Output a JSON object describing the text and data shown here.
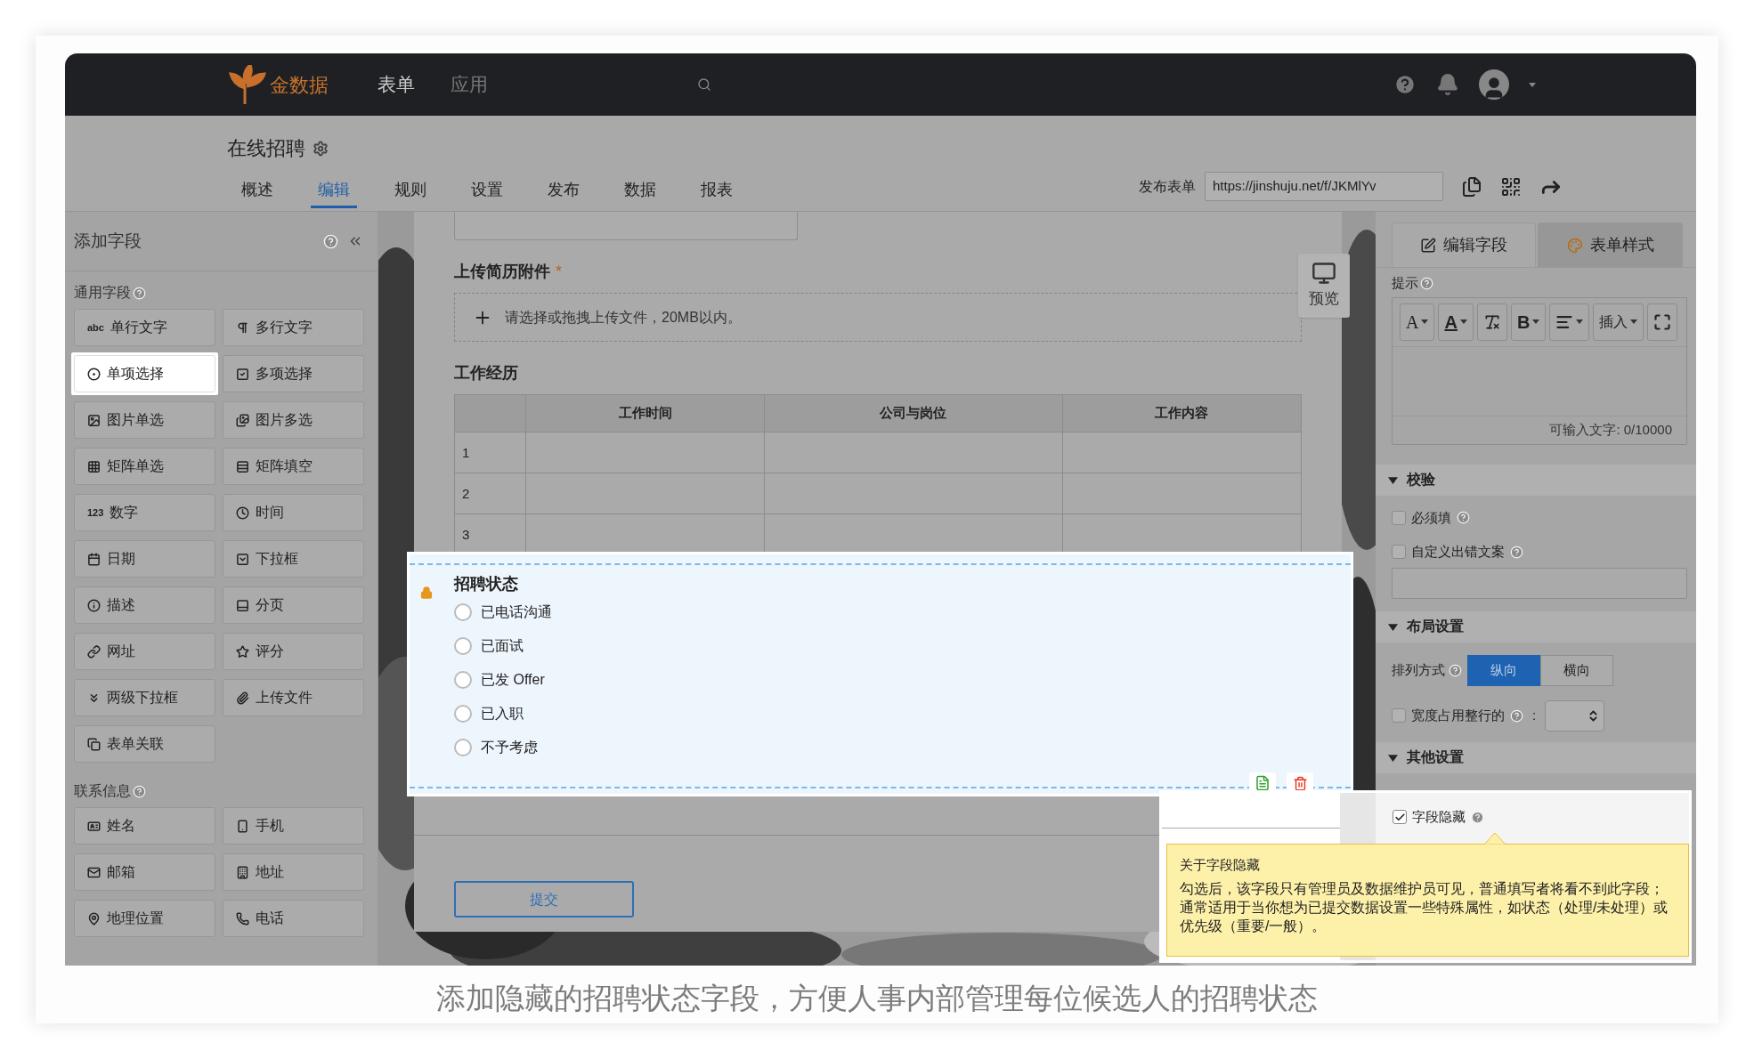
{
  "brand": {
    "name": "金数据"
  },
  "top_nav": [
    {
      "label": "表单",
      "selected": true
    },
    {
      "label": "应用",
      "selected": false
    }
  ],
  "form_title": "在线招聘",
  "tabs": [
    {
      "label": "概述",
      "selected": false
    },
    {
      "label": "编辑",
      "selected": true
    },
    {
      "label": "规则",
      "selected": false
    },
    {
      "label": "设置",
      "selected": false
    },
    {
      "label": "发布",
      "selected": false
    },
    {
      "label": "数据",
      "selected": false
    },
    {
      "label": "报表",
      "selected": false
    }
  ],
  "publish": {
    "label": "发布表单",
    "url": "https://jinshuju.net/f/JKMlYv"
  },
  "left_panel": {
    "title": "添加字段",
    "groups": [
      {
        "title": "通用字段",
        "items": [
          {
            "label": "单行文字",
            "glyph": "abc",
            "highlighted": false
          },
          {
            "label": "多行文字",
            "highlighted": false
          },
          {
            "label": "单项选择",
            "highlighted": true
          },
          {
            "label": "多项选择",
            "highlighted": false
          },
          {
            "label": "图片单选",
            "highlighted": false
          },
          {
            "label": "图片多选",
            "highlighted": false
          },
          {
            "label": "矩阵单选",
            "highlighted": false
          },
          {
            "label": "矩阵填空",
            "highlighted": false
          },
          {
            "label": "数字",
            "glyph": "123",
            "highlighted": false
          },
          {
            "label": "时间",
            "highlighted": false
          },
          {
            "label": "日期",
            "highlighted": false
          },
          {
            "label": "下拉框",
            "highlighted": false
          },
          {
            "label": "描述",
            "highlighted": false
          },
          {
            "label": "分页",
            "highlighted": false
          },
          {
            "label": "网址",
            "highlighted": false
          },
          {
            "label": "评分",
            "highlighted": false
          },
          {
            "label": "两级下拉框",
            "highlighted": false
          },
          {
            "label": "上传文件",
            "highlighted": false
          },
          {
            "label": "表单关联",
            "highlighted": false
          }
        ]
      },
      {
        "title": "联系信息",
        "items": [
          {
            "label": "姓名",
            "highlighted": false
          },
          {
            "label": "手机",
            "highlighted": false
          },
          {
            "label": "邮箱",
            "highlighted": false
          },
          {
            "label": "地址",
            "highlighted": false
          },
          {
            "label": "地理位置",
            "highlighted": false
          },
          {
            "label": "电话",
            "highlighted": false
          }
        ]
      }
    ]
  },
  "form": {
    "upload": {
      "label": "上传简历附件",
      "required_mark": "*",
      "placeholder": "请选择或拖拽上传文件，20MB以内。"
    },
    "preview": "预览",
    "table": {
      "title": "工作经历",
      "columns": [
        "",
        "工作时间",
        "公司与岗位",
        "工作内容"
      ],
      "rows": [
        "1",
        "2",
        "3"
      ]
    },
    "status_field": {
      "title": "招聘状态",
      "locked": true,
      "options": [
        {
          "label": "已电话沟通",
          "selected": false
        },
        {
          "label": "已面试",
          "selected": false
        },
        {
          "label": "已发 Offer",
          "selected": false
        },
        {
          "label": "已入职",
          "selected": false
        },
        {
          "label": "不予考虑",
          "selected": false
        }
      ]
    },
    "submit": "提交"
  },
  "right_panel": {
    "tabs": [
      {
        "label": "编辑字段",
        "selected": true
      },
      {
        "label": "表单样式",
        "selected": false
      }
    ],
    "hint_label": "提示",
    "toolbar": [
      {
        "kind": "font_size",
        "label": "A"
      },
      {
        "kind": "font_color",
        "label": "A"
      },
      {
        "kind": "clear_format"
      },
      {
        "kind": "bold",
        "label": "B"
      },
      {
        "kind": "align"
      },
      {
        "kind": "insert",
        "label": "插入"
      },
      {
        "kind": "fullscreen"
      }
    ],
    "counter": "可输入文字: 0/10000",
    "validation": {
      "title": "校验",
      "expanded": true,
      "required": {
        "label": "必须填",
        "checked": false
      },
      "custom_error": {
        "label": "自定义出错文案",
        "checked": false
      }
    },
    "layout": {
      "title": "布局设置",
      "expanded": true,
      "arrange_label": "排列方式",
      "arrange_options": [
        {
          "label": "纵向",
          "selected": true
        },
        {
          "label": "横向",
          "selected": false
        }
      ],
      "full_width": {
        "label": "宽度占用整行的",
        "checked": false
      },
      "colon": ":"
    },
    "other": {
      "title": "其他设置",
      "expanded": true,
      "hidden_field": {
        "label": "字段隐藏",
        "checked": true
      }
    }
  },
  "tooltip": {
    "title": "关于字段隐藏",
    "body": "勾选后，该字段只有管理员及数据维护员可见，普通填写者将看不到此字段；通常适用于当你想为已提交数据设置一些特殊属性，如状态（处理/未处理）或优先级（重要/一般）。"
  },
  "caption": "添加隐藏的招聘状态字段，方便人事内部管理每位候选人的招聘状态"
}
